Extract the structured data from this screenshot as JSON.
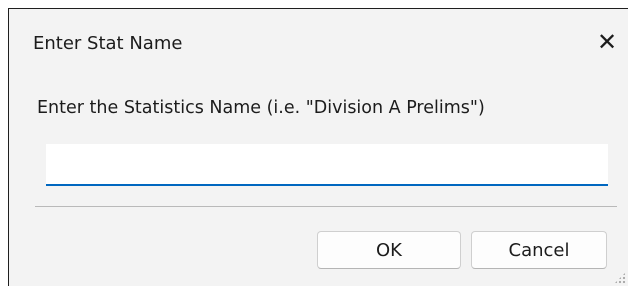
{
  "dialog": {
    "title": "Enter Stat Name",
    "close_glyph": "✕",
    "prompt": "Enter the Statistics Name (i.e. \"Division A Prelims\")",
    "input_value": "",
    "ok_label": "OK",
    "cancel_label": "Cancel",
    "accent_color": "#0067c0"
  }
}
